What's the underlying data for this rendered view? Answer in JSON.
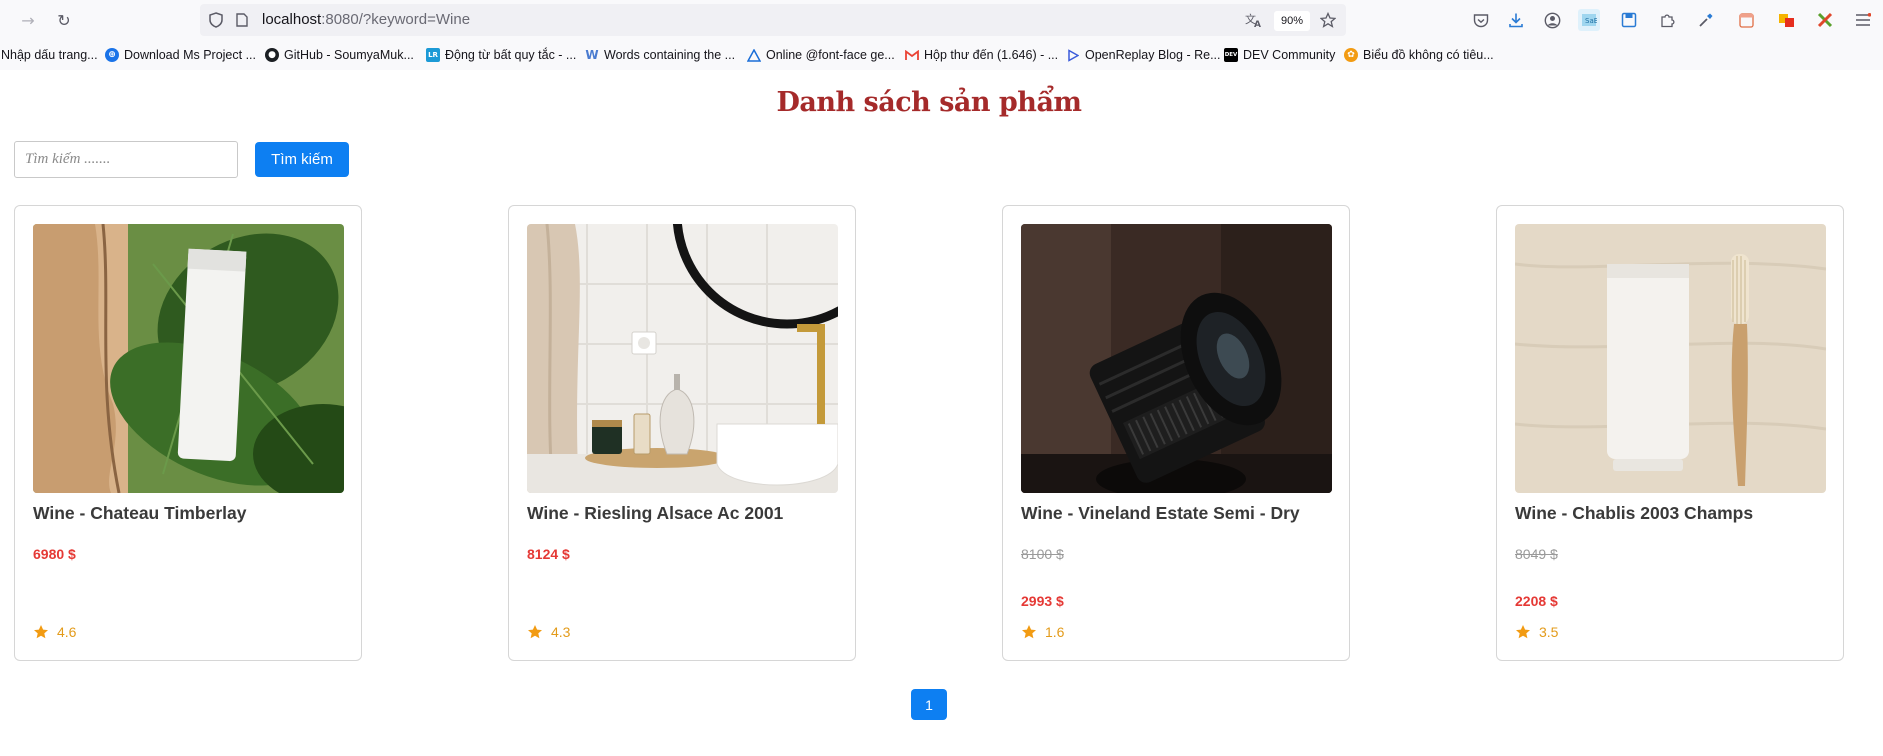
{
  "browser": {
    "url_host": "localhost",
    "url_rest": ":8080/?keyword=Wine",
    "zoom": "90%"
  },
  "bookmarks": [
    {
      "label": "Nhập dấu trang...",
      "icon": "none"
    },
    {
      "label": "Download Ms Project ...",
      "icon": "globe-icon"
    },
    {
      "label": "GitHub - SoumyaMuk...",
      "icon": "github-icon"
    },
    {
      "label": "Động từ bất quy tắc - ...",
      "icon": "lr-icon"
    },
    {
      "label": "Words containing the ...",
      "icon": "w-icon"
    },
    {
      "label": "Online @font-face ge...",
      "icon": "triangle-icon"
    },
    {
      "label": "Hộp thư đến (1.646) - ...",
      "icon": "gmail-icon"
    },
    {
      "label": "OpenReplay Blog - Re...",
      "icon": "play-icon"
    },
    {
      "label": "DEV Community",
      "icon": "dev-icon"
    },
    {
      "label": "Biểu đồ không có tiêu...",
      "icon": "chart-icon"
    }
  ],
  "page": {
    "title": "Danh sách sản phẩm",
    "search_placeholder": "Tìm kiếm .......",
    "search_button": "Tìm kiếm"
  },
  "products": [
    {
      "name": "Wine - Chateau Timberlay",
      "price": "6980 $",
      "old_price": "",
      "sale_price": "",
      "rating": "4.6",
      "image": "tube-on-leaves"
    },
    {
      "name": "Wine - Riesling Alsace Ac 2001",
      "price": "8124 $",
      "old_price": "",
      "sale_price": "",
      "rating": "4.3",
      "image": "bathroom-sink"
    },
    {
      "name": "Wine - Vineland Estate Semi - Dry",
      "price": "",
      "old_price": "8100 $",
      "sale_price": "2993 $",
      "rating": "1.6",
      "image": "camera-lens"
    },
    {
      "name": "Wine - Chablis 2003 Champs",
      "price": "",
      "old_price": "8049 $",
      "sale_price": "2208 $",
      "rating": "3.5",
      "image": "tube-and-toothbrush"
    }
  ],
  "pagination": {
    "current": "1"
  },
  "colors": {
    "accent": "#0d7ff2",
    "title": "#a52a2a",
    "price": "#e53935",
    "rating": "#e39b1a"
  }
}
